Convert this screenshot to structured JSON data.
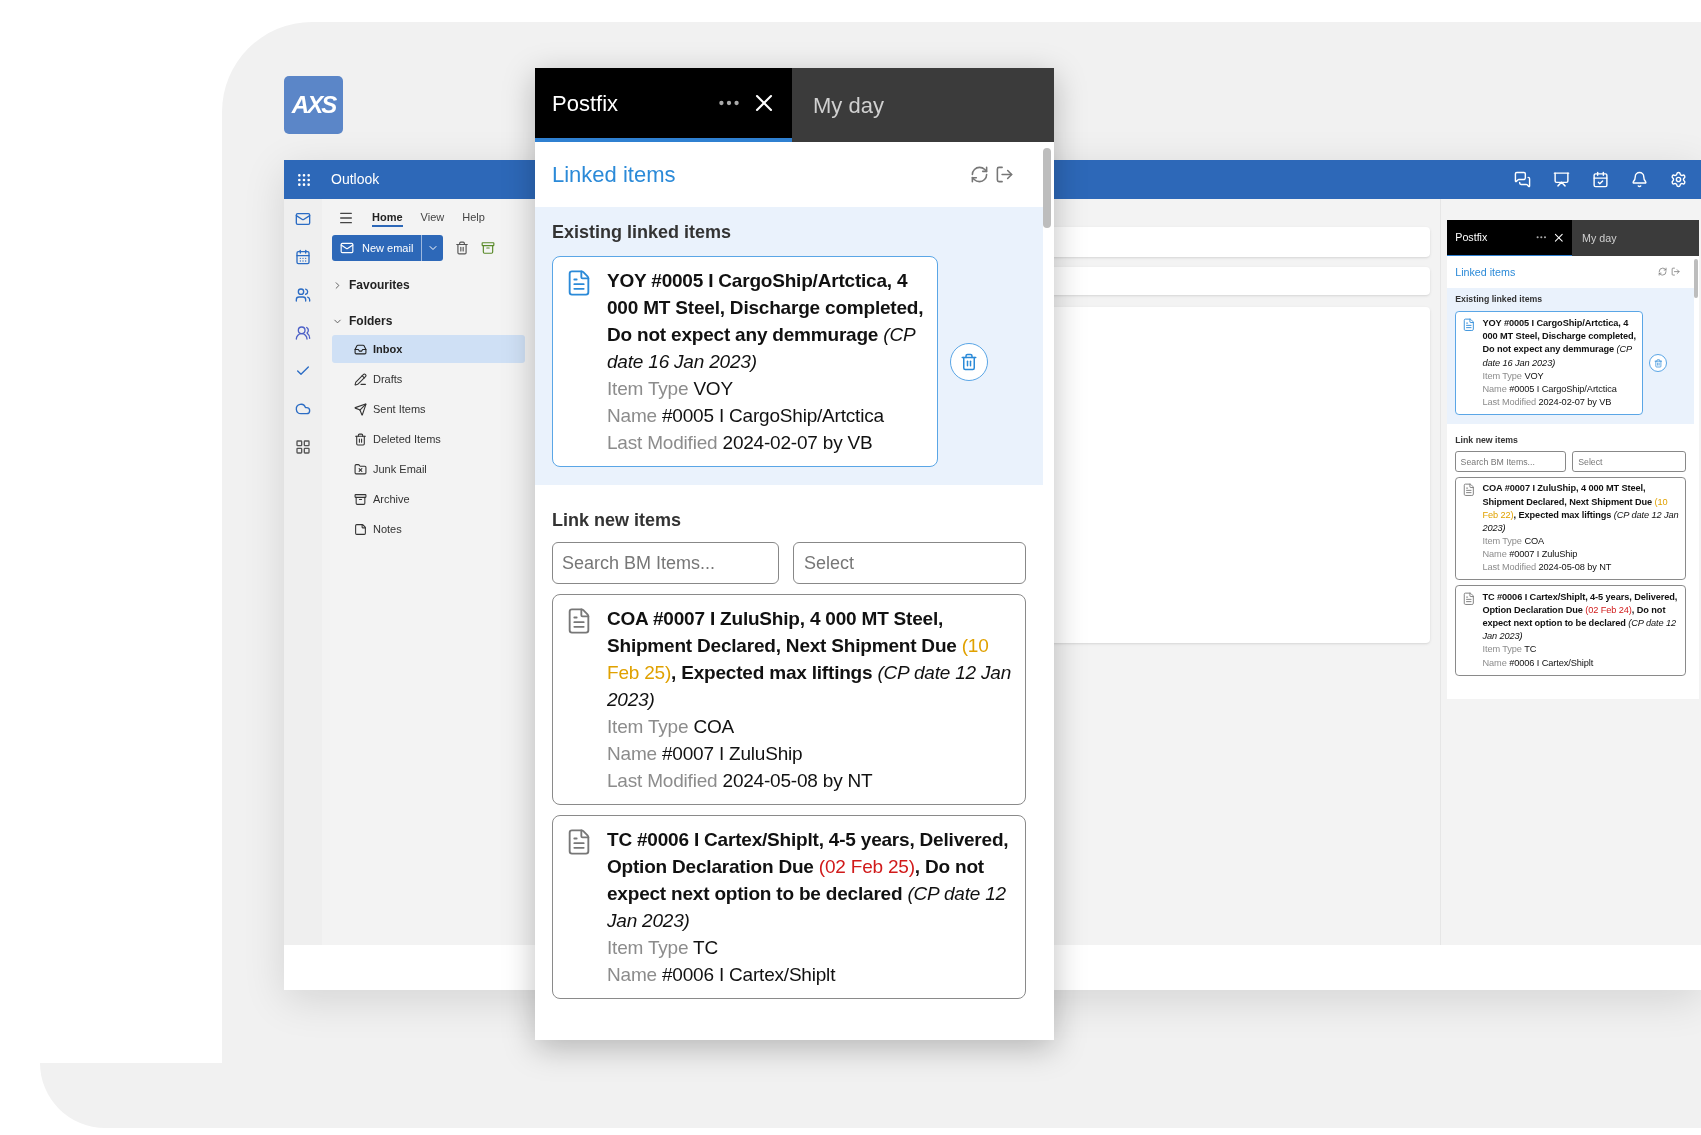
{
  "logo": {
    "text": "AXS"
  },
  "outlook": {
    "app_name": "Outlook",
    "ribbon_tabs": [
      {
        "label": "Home",
        "selected": true
      },
      {
        "label": "View",
        "selected": false
      },
      {
        "label": "Help",
        "selected": false
      }
    ],
    "new_email_button": "New email",
    "sections": [
      {
        "label": "Favourites",
        "expanded": false
      },
      {
        "label": "Folders",
        "expanded": true
      }
    ],
    "folders": [
      {
        "label": "Inbox",
        "selected": true
      },
      {
        "label": "Drafts",
        "selected": false
      },
      {
        "label": "Sent Items",
        "selected": false
      },
      {
        "label": "Deleted Items",
        "selected": false
      },
      {
        "label": "Junk Email",
        "selected": false
      },
      {
        "label": "Archive",
        "selected": false
      },
      {
        "label": "Notes",
        "selected": false
      }
    ]
  },
  "panels": [
    {
      "tabs": [
        {
          "label": "Postfix",
          "selected": true
        },
        {
          "label": "My day",
          "selected": false
        }
      ],
      "heading": "Linked items",
      "existing_heading": "Existing linked items",
      "existing_items": [
        {
          "title": [
            {
              "text": "YOY #0005 I CargoShip/Artctica, 4 000 MT Steel, Discharge completed, Do not expect any demmurage ",
              "kind": "normal"
            },
            {
              "text": "(CP date 16 Jan 2023)",
              "kind": "italic"
            }
          ],
          "fields": [
            {
              "label": "Item Type",
              "value": "VOY"
            },
            {
              "label": "Name",
              "value": "#0005 I CargoShip/Artctica"
            },
            {
              "label": "Last Modified",
              "value": "2024-02-07 by VB"
            }
          ]
        }
      ],
      "link_heading": "Link new items",
      "search": {
        "placeholder": "Search BM Items..."
      },
      "select": {
        "placeholder": "Select"
      },
      "new_items": [
        {
          "title": [
            {
              "text": "COA #0007 I ZuluShip, 4 000 MT Steel, Shipment Declared, Next Shipment Due ",
              "kind": "normal"
            },
            {
              "text": "(10 Feb 25)",
              "kind": "warning"
            },
            {
              "text": ", Expected max liftings ",
              "kind": "normal"
            },
            {
              "text": "(CP date 12 Jan 2023)",
              "kind": "italic"
            }
          ],
          "fields": [
            {
              "label": "Item Type",
              "value": "COA"
            },
            {
              "label": "Name",
              "value": "#0007 I ZuluShip"
            },
            {
              "label": "Last Modified",
              "value": "2024-05-08 by NT"
            }
          ]
        },
        {
          "title": [
            {
              "text": "TC #0006 I Cartex/Shiplt, 4-5 years, Delivered, Option Declaration Due ",
              "kind": "normal"
            },
            {
              "text": "(02 Feb 25)",
              "kind": "overdue"
            },
            {
              "text": ", Do not expect next option to be declared ",
              "kind": "normal"
            },
            {
              "text": "(CP date 12 Jan 2023)",
              "kind": "italic"
            }
          ],
          "fields": [
            {
              "label": "Item Type",
              "value": "TC"
            },
            {
              "label": "Name",
              "value": "#0006 I Cartex/Shiplt"
            }
          ]
        }
      ]
    },
    {
      "tabs": [
        {
          "label": "Postfix",
          "selected": true
        },
        {
          "label": "My day",
          "selected": false
        }
      ],
      "heading": "Linked items",
      "existing_heading": "Existing linked items",
      "existing_items": [
        {
          "title": [
            {
              "text": "YOY #0005 I CargoShip/Artctica, 4 000 MT Steel, Discharge completed, Do not expect any demmurage ",
              "kind": "normal"
            },
            {
              "text": "(CP date 16 Jan 2023)",
              "kind": "italic"
            }
          ],
          "fields": [
            {
              "label": "Item Type",
              "value": "VOY"
            },
            {
              "label": "Name",
              "value": "#0005 I CargoShip/Artctica"
            },
            {
              "label": "Last Modified",
              "value": "2024-02-07 by VB"
            }
          ]
        }
      ],
      "link_heading": "Link new items",
      "search": {
        "placeholder": "Search BM Items..."
      },
      "select": {
        "placeholder": "Select"
      },
      "new_items": [
        {
          "title": [
            {
              "text": "COA #0007 I ZuluShip, 4 000 MT Steel, Shipment Declared, Next Shipment Due ",
              "kind": "normal"
            },
            {
              "text": "(10 Feb 22)",
              "kind": "warning"
            },
            {
              "text": ", Expected max liftings ",
              "kind": "normal"
            },
            {
              "text": "(CP date 12 Jan 2023)",
              "kind": "italic"
            }
          ],
          "fields": [
            {
              "label": "Item Type",
              "value": "COA"
            },
            {
              "label": "Name",
              "value": "#0007 I ZuluShip"
            },
            {
              "label": "Last Modified",
              "value": "2024-05-08 by NT"
            }
          ]
        },
        {
          "title": [
            {
              "text": "TC #0006 I Cartex/Shiplt, 4-5 years, Delivered, Option Declaration Due ",
              "kind": "normal"
            },
            {
              "text": "(02 Feb 24)",
              "kind": "overdue"
            },
            {
              "text": ", Do not expect next option to be declared ",
              "kind": "normal"
            },
            {
              "text": "(CP date 12 Jan 2023)",
              "kind": "italic"
            }
          ],
          "fields": [
            {
              "label": "Item Type",
              "value": "TC"
            },
            {
              "label": "Name",
              "value": "#0006 I Cartex/Shiplt"
            }
          ]
        }
      ]
    }
  ]
}
